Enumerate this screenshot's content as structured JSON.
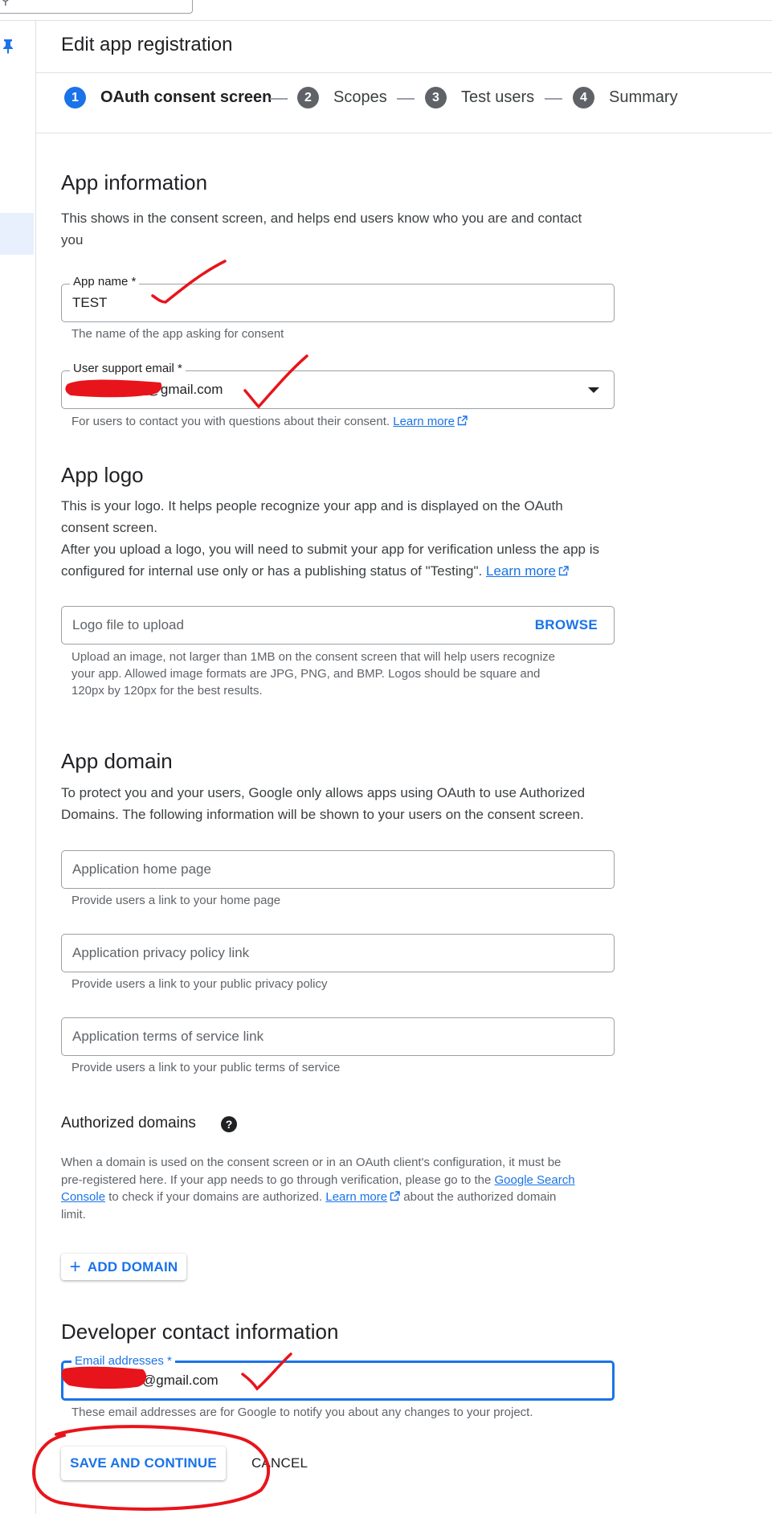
{
  "header": {
    "title": "Edit app registration"
  },
  "stepper": [
    {
      "num": "1",
      "label": "OAuth consent screen"
    },
    {
      "num": "2",
      "label": "Scopes"
    },
    {
      "num": "3",
      "label": "Test users"
    },
    {
      "num": "4",
      "label": "Summary"
    }
  ],
  "app_info": {
    "heading": "App information",
    "desc_1": "This shows in the consent screen, and helps end users know who you are and contact",
    "desc_2": "you",
    "app_name": {
      "label": "App name *",
      "value": "TEST",
      "helper": "The name of the app asking for consent"
    },
    "support_email": {
      "label": "User support email *",
      "value": "r@gmail.com",
      "helper": "For users to contact you with questions about their consent.",
      "link": "Learn more"
    }
  },
  "app_logo": {
    "heading": "App logo",
    "desc_1": "This is your logo. It helps people recognize your app and is displayed on the OAuth",
    "desc_2": "consent screen.",
    "desc_3": "After you upload a logo, you will need to submit your app for verification unless the app is",
    "desc_4": "configured for internal use only or has a publishing status of \"Testing\".",
    "link": "Learn more",
    "upload_placeholder": "Logo file to upload",
    "browse": "BROWSE",
    "helper_1": "Upload an image, not larger than 1MB on the consent screen that will help users recognize",
    "helper_2": "your app. Allowed image formats are JPG, PNG, and BMP. Logos should be square and",
    "helper_3": "120px by 120px for the best results."
  },
  "app_domain": {
    "heading": "App domain",
    "desc_1": "To protect you and your users, Google only allows apps using OAuth to use Authorized",
    "desc_2": "Domains. The following information will be shown to your users on the consent screen.",
    "home": {
      "placeholder": "Application home page",
      "helper": "Provide users a link to your home page"
    },
    "privacy": {
      "placeholder": "Application privacy policy link",
      "helper": "Provide users a link to your public privacy policy"
    },
    "terms": {
      "placeholder": "Application terms of service link",
      "helper": "Provide users a link to your public terms of service"
    }
  },
  "authorized_domains": {
    "heading": "Authorized domains",
    "help_icon": "?",
    "line_1": "When a domain is used on the consent screen or in an OAuth client's configuration, it must be",
    "line_2a": "pre-registered here. If your app needs to go through verification, please go to the",
    "link_search_1": "Google Search",
    "link_search_2": "Console",
    "line_3a": "to check if your domains are authorized.",
    "link_learn": "Learn more",
    "line_3b": "about the authorized domain",
    "line_4": "limit.",
    "add_domain": "ADD DOMAIN"
  },
  "developer_contact": {
    "heading": "Developer contact information",
    "label": "Email addresses *",
    "value": "@gmail.com",
    "helper": "These email addresses are for Google to notify you about any changes to your project."
  },
  "actions": {
    "save": "SAVE AND CONTINUE",
    "cancel": "CANCEL"
  },
  "colors": {
    "accent": "#1a73e8",
    "annotation": "#e8141b",
    "text": "#202124",
    "muted": "#5f6368"
  },
  "icons": [
    "search-icon",
    "pin-icon",
    "dropdown-arrow-icon",
    "external-link-icon",
    "help-icon",
    "plus-icon"
  ]
}
